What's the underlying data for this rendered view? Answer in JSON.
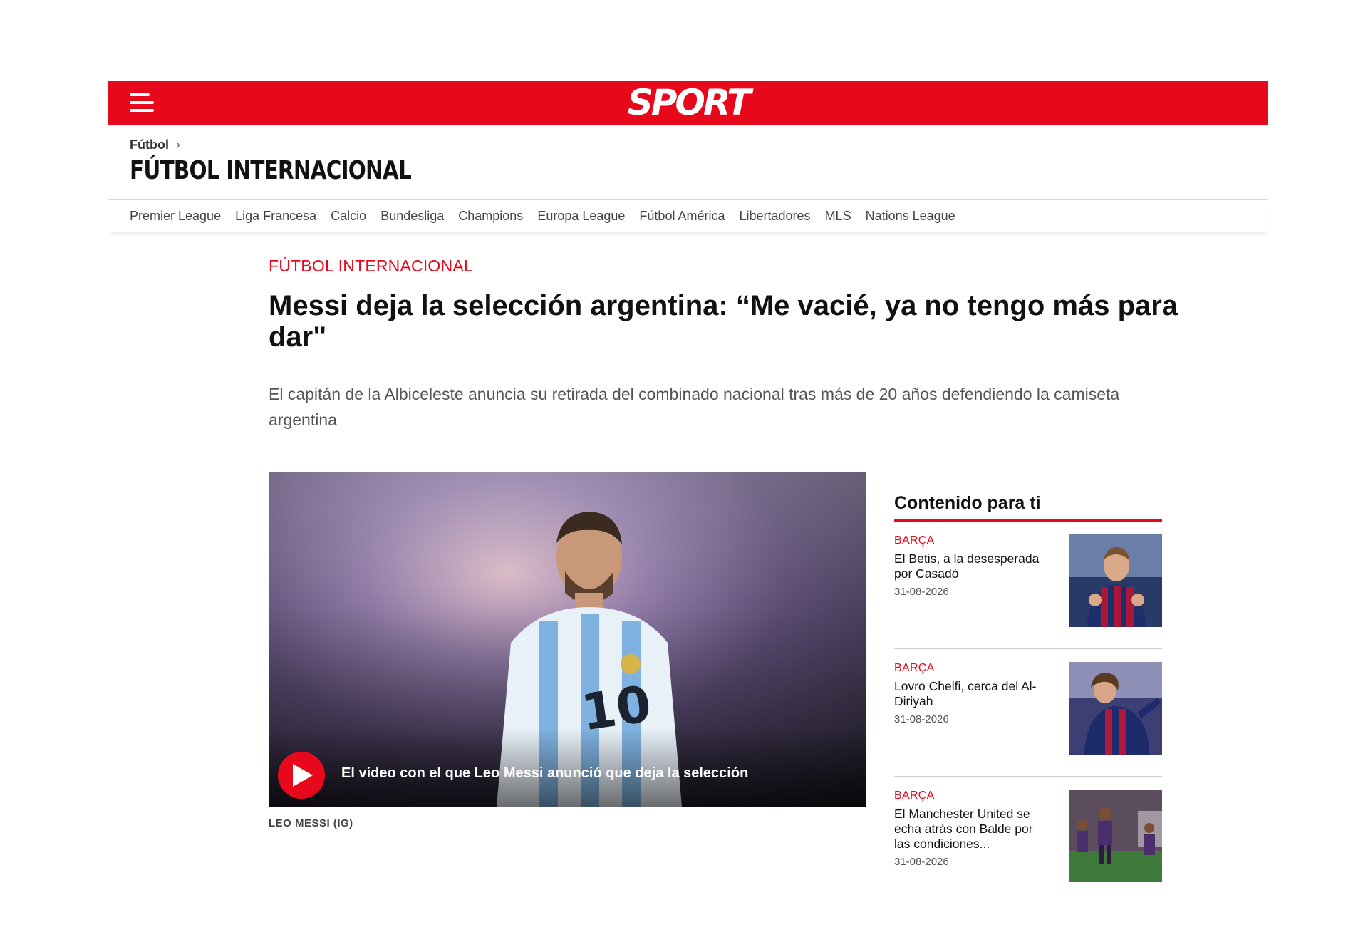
{
  "header": {
    "logo": "SPORT",
    "brand_color": "#e8081c"
  },
  "section": {
    "breadcrumb": "Fútbol",
    "title": "FÚTBOL INTERNACIONAL",
    "subnav": [
      "Premier League",
      "Liga Francesa",
      "Calcio",
      "Bundesliga",
      "Champions",
      "Europa League",
      "Fútbol América",
      "Libertadores",
      "MLS",
      "Nations League"
    ]
  },
  "article": {
    "kicker": "FÚTBOL INTERNACIONAL",
    "headline": "Messi deja la selección argentina: “Me vacié, ya no tengo más para dar\"",
    "dek": "El capitán de la Albiceleste anuncia su retirada del combinado nacional tras más de 20 años defendiendo la camiseta argentina",
    "video_title": "El vídeo con el que Leo Messi anunció que deja la selección",
    "photo_credit": "LEO MESSI (IG)"
  },
  "sidebar": {
    "title": "Contenido para ti",
    "items": [
      {
        "category": "BARÇA",
        "title": "El Betis, a la desesperada por Casadó",
        "date": "31-08-2026"
      },
      {
        "category": "BARÇA",
        "title": "Lovro Chelfi, cerca del Al-Diriyah",
        "date": "31-08-2026"
      },
      {
        "category": "BARÇA",
        "title": "El Manchester United se echa atrás con Balde por las condiciones...",
        "date": "31-08-2026"
      }
    ]
  }
}
